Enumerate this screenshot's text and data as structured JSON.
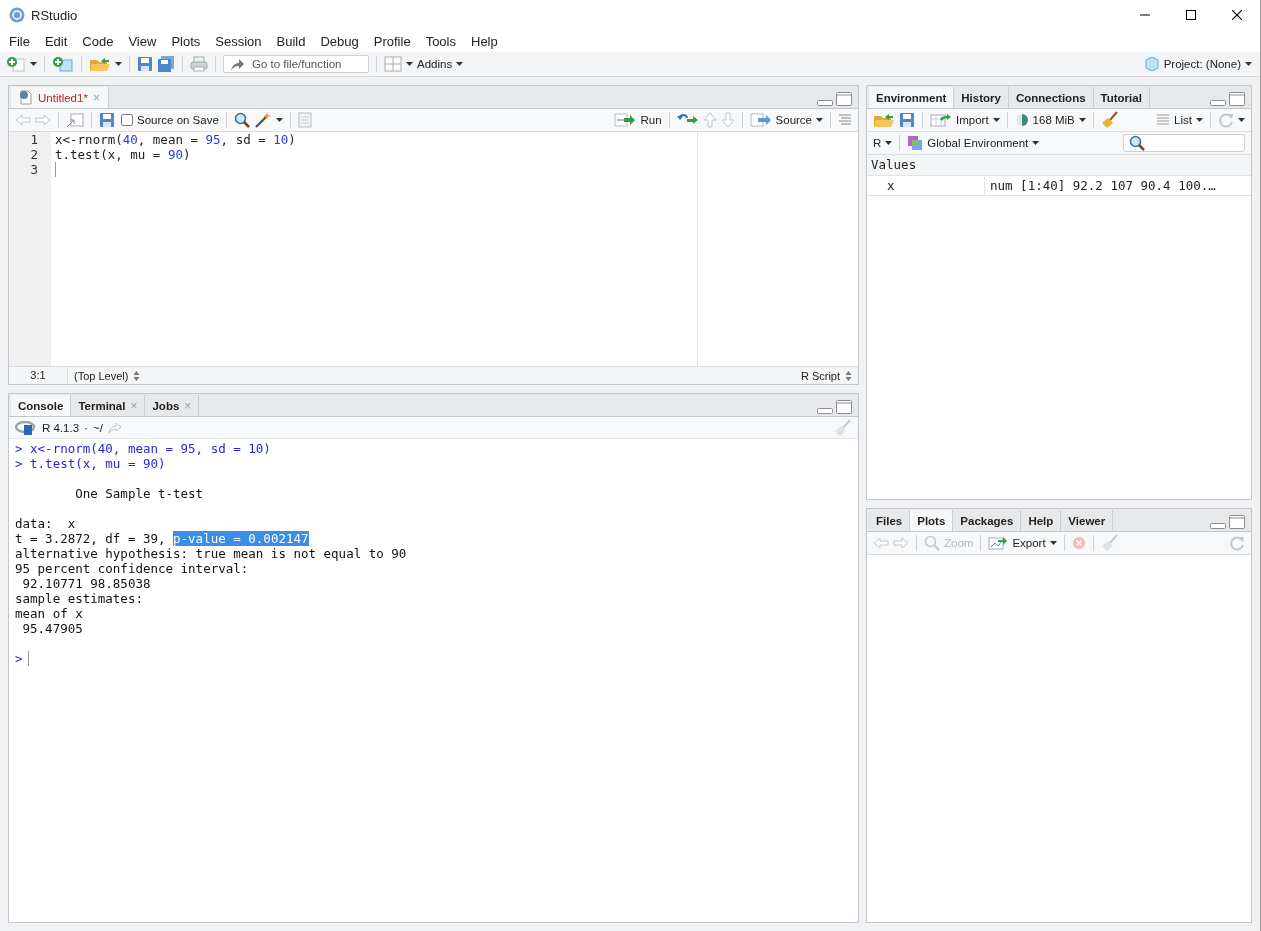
{
  "window": {
    "title": "RStudio"
  },
  "menu": [
    "File",
    "Edit",
    "Code",
    "View",
    "Plots",
    "Session",
    "Build",
    "Debug",
    "Profile",
    "Tools",
    "Help"
  ],
  "toolbar": {
    "goto_placeholder": "Go to file/function",
    "addins": "Addins",
    "project": "Project: (None)"
  },
  "editor": {
    "tabs": [
      {
        "label": "Untitled1*",
        "close": "×",
        "modified": true,
        "selected": true
      }
    ],
    "source_on_save": {
      "label": "Source on Save",
      "checked": false
    },
    "run": "Run",
    "source": "Source",
    "lines": [
      {
        "number": "1",
        "cursor": false,
        "tokens": [
          {
            "text": "x<-rnorm(",
            "kind": "plain"
          },
          {
            "text": "40",
            "kind": "number"
          },
          {
            "text": ", mean = ",
            "kind": "plain"
          },
          {
            "text": "95",
            "kind": "number"
          },
          {
            "text": ", sd = ",
            "kind": "plain"
          },
          {
            "text": "10",
            "kind": "number"
          },
          {
            "text": ")",
            "kind": "plain"
          }
        ]
      },
      {
        "number": "2",
        "cursor": false,
        "tokens": [
          {
            "text": "t.test(x, mu = ",
            "kind": "plain"
          },
          {
            "text": "90",
            "kind": "number"
          },
          {
            "text": ")",
            "kind": "plain"
          }
        ]
      },
      {
        "number": "3",
        "cursor": true
      }
    ],
    "cursor_position": "3:1",
    "scope": "(Top Level)",
    "file_type": "R Script"
  },
  "console": {
    "tabs": [
      {
        "label": "Console",
        "selected": true
      },
      {
        "label": "Terminal",
        "close": "×",
        "selected": false
      },
      {
        "label": "Jobs",
        "close": "×",
        "selected": false
      }
    ],
    "version": "R 4.1.3",
    "separator": "·",
    "path": "~/",
    "lines": [
      {
        "kind": "input",
        "text": "> x<-rnorm(40, mean = 95, sd = 10)"
      },
      {
        "kind": "input",
        "text": "> t.test(x, mu = 90)"
      },
      {
        "kind": "blank"
      },
      {
        "kind": "output",
        "text": "        One Sample t-test"
      },
      {
        "kind": "blank"
      },
      {
        "kind": "output",
        "text": "data:  x"
      },
      {
        "kind": "output",
        "segments": [
          {
            "text": "t = 3.2872, df = 39, ",
            "selected": false
          },
          {
            "text": "p-value = 0.002147",
            "selected": true
          }
        ]
      },
      {
        "kind": "output",
        "text": "alternative hypothesis: true mean is not equal to 90"
      },
      {
        "kind": "output",
        "text": "95 percent confidence interval:"
      },
      {
        "kind": "output",
        "text": " 92.10771 98.85038"
      },
      {
        "kind": "output",
        "text": "sample estimates:"
      },
      {
        "kind": "output",
        "text": "mean of x"
      },
      {
        "kind": "output",
        "text": " 95.47905"
      },
      {
        "kind": "blank"
      },
      {
        "kind": "prompt",
        "text": ">"
      }
    ]
  },
  "environment": {
    "tabs": [
      {
        "label": "Environment",
        "selected": true
      },
      {
        "label": "History",
        "selected": false
      },
      {
        "label": "Connections",
        "selected": false
      },
      {
        "label": "Tutorial",
        "selected": false
      }
    ],
    "import": "Import",
    "memory": "168 MiB",
    "view": "List",
    "language": "R",
    "scope": "Global Environment",
    "section": "Values",
    "variables": [
      {
        "name": "x",
        "value": "num [1:40] 92.2 107 90.4 100.…"
      }
    ]
  },
  "files": {
    "tabs": [
      {
        "label": "Files",
        "selected": false
      },
      {
        "label": "Plots",
        "selected": true
      },
      {
        "label": "Packages",
        "selected": false
      },
      {
        "label": "Help",
        "selected": false
      },
      {
        "label": "Viewer",
        "selected": false
      }
    ],
    "buttons": [
      {
        "kind": "zoom",
        "label": "Zoom",
        "disabled": true
      },
      {
        "kind": "export",
        "label": "Export",
        "disabled": false
      }
    ]
  }
}
